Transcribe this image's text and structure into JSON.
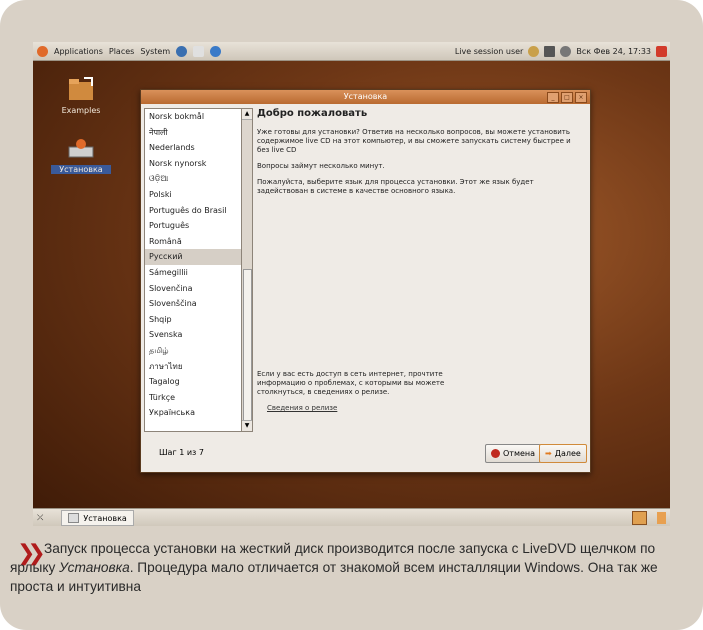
{
  "topbar": {
    "menus": [
      "Applications",
      "Places",
      "System"
    ],
    "user": "Live session user",
    "datetime": "Вск Фев 24, 17:33"
  },
  "desktop": {
    "icons": [
      {
        "label": "Examples"
      },
      {
        "label": "Установка"
      }
    ]
  },
  "window": {
    "title": "Установка",
    "languages": [
      "Norsk bokmål",
      "नेपाली",
      "Nederlands",
      "Norsk nynorsk",
      "ଓଡ଼ିଆ",
      "Polski",
      "Português do Brasil",
      "Português",
      "Română",
      "Русский",
      "Sámegillii",
      "Slovenčina",
      "Slovenščina",
      "Shqip",
      "Svenska",
      "தமிழ்",
      "ภาษาไทย",
      "Tagalog",
      "Türkçe",
      "Українська"
    ],
    "selected_language": "Русский",
    "heading": "Добро пожаловать",
    "para1": "Уже готовы для установки? Ответив на несколько вопросов, вы можете установить содержимое live CD на этот компьютер, и вы сможете запускать систему быстрее и без live CD",
    "para2": "Вопросы займут несколько минут.",
    "para3": "Пожалуйста, выберите язык для процесса установки. Этот же язык будет задействован в системе в качестве основного языка.",
    "para4": "Если у вас есть доступ в сеть интернет, прочтите информацию о проблемах, с которыми вы можете столкнуться, в сведениях о релизе.",
    "release_link": "Сведения о релизе",
    "step": "Шаг 1 из 7",
    "cancel": "Отмена",
    "next": "Далее"
  },
  "taskbar": {
    "task": "Установка"
  },
  "caption": {
    "text_before": "Запуск процесса установки на жесткий диск производится после запуска с LiveDVD щелчком по ярлыку ",
    "text_em": "Установка",
    "text_after": ". Процедура мало отличается от знакомой всем инсталляции Windows. Она так же проста и интуитивна"
  },
  "colors": {
    "accent_red": "#b01c1c",
    "title_orange": "#c67a3e"
  }
}
